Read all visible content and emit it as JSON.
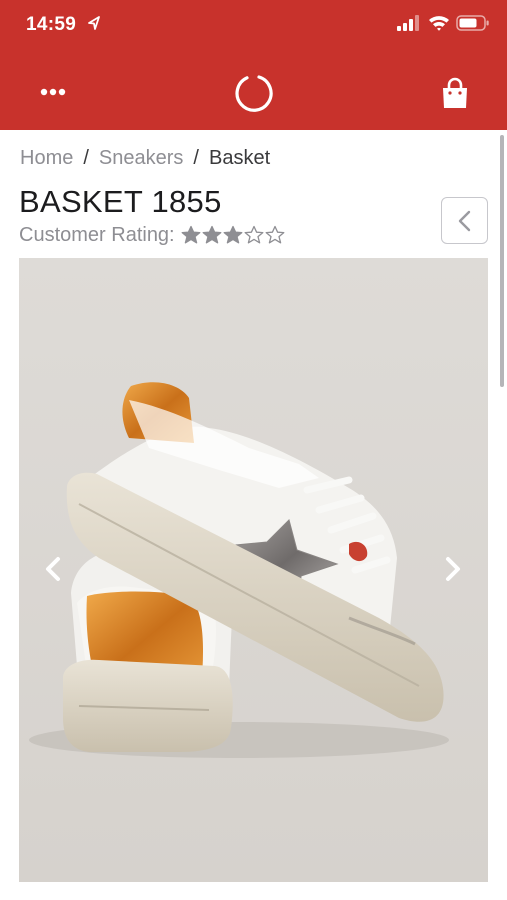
{
  "status_bar": {
    "time": "14:59"
  },
  "app_bar": {
    "menu_icon": "more-dots-icon",
    "logo_icon": "ring-logo-icon",
    "cart_icon": "shopping-bag-icon",
    "accent_color": "#c8322c"
  },
  "breadcrumb": {
    "items": [
      "Home",
      "Sneakers",
      "Basket"
    ],
    "separator": "/"
  },
  "product": {
    "title": "BASKET 1855",
    "rating_label": "Customer Rating:",
    "rating": 3,
    "rating_max": 5
  },
  "nav": {
    "back_icon": "chevron-left-icon"
  },
  "carousel": {
    "prev_icon": "chevron-left-icon",
    "next_icon": "chevron-right-icon"
  }
}
